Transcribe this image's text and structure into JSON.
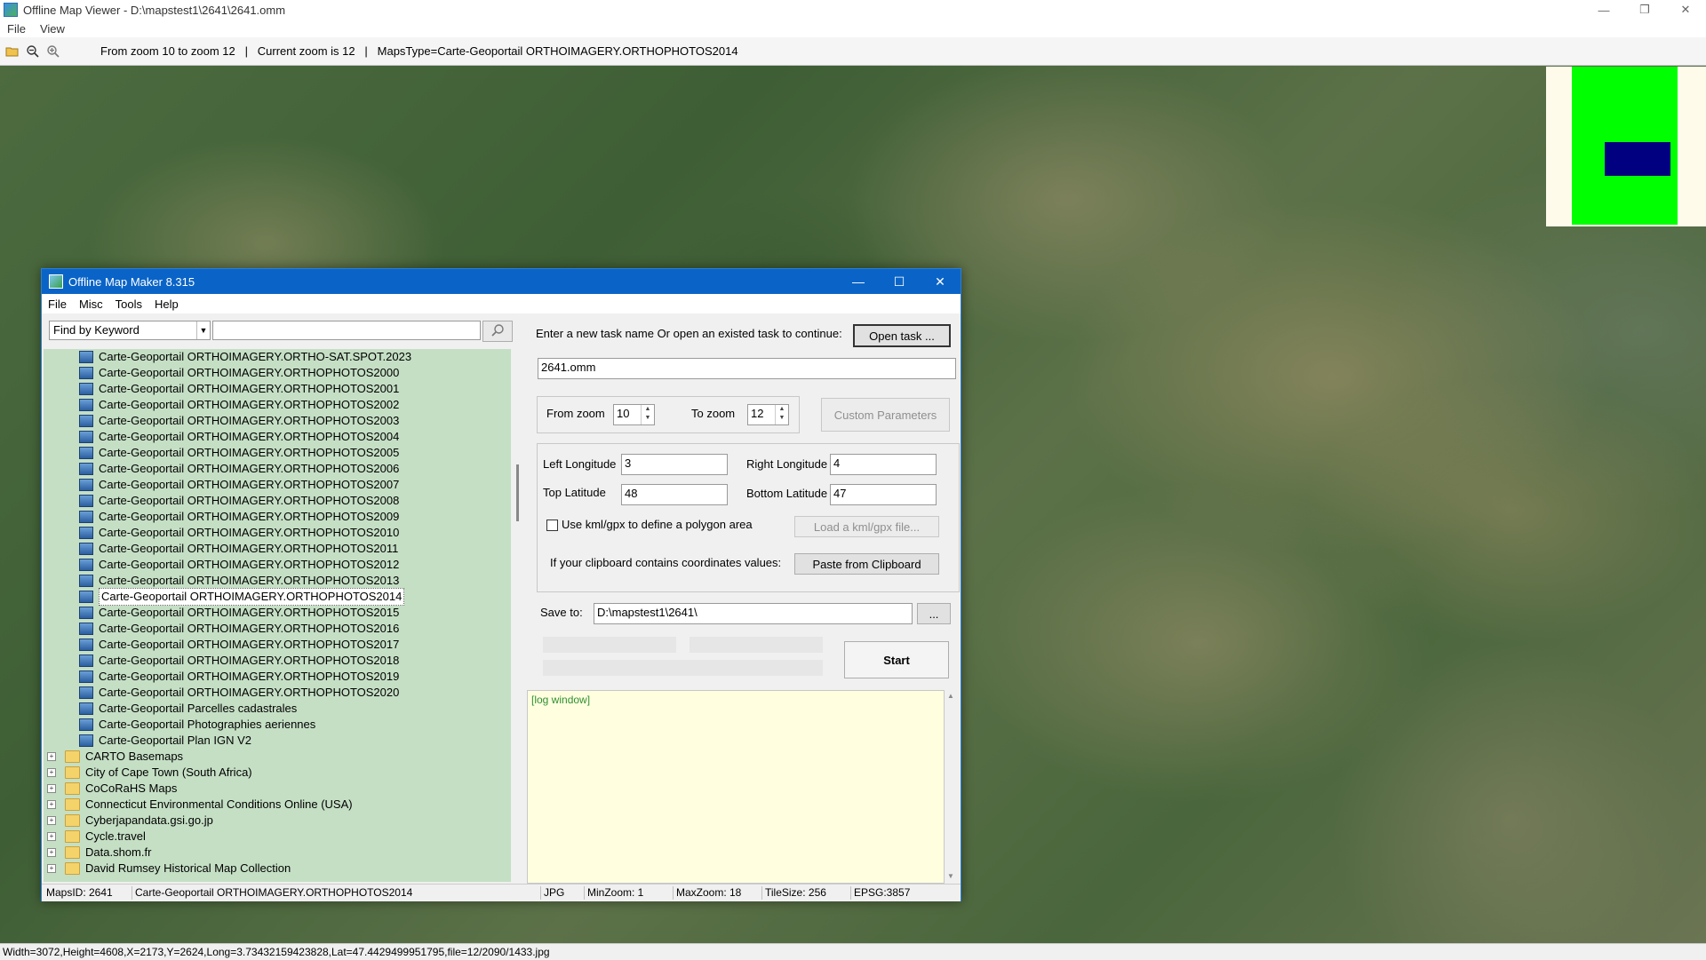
{
  "window": {
    "title": "Offline Map Viewer - D:\\mapstest1\\2641\\2641.omm",
    "controls": {
      "minimize": "—",
      "maximize": "❐",
      "close": "✕"
    }
  },
  "menu": [
    "File",
    "View"
  ],
  "toolbar": {
    "icons": [
      "open-folder-icon",
      "zoom-out-icon",
      "zoom-in-icon"
    ],
    "info": "From zoom 10 to zoom 12   |   Current zoom is 12   |   MapsType=Carte-Geoportail ORTHOIMAGERY.ORTHOPHOTOS2014"
  },
  "statusbar": "Width=3072,Height=4608,X=2173,Y=2624,Long=3.73432159423828,Lat=47.4429499951795,file=12/2090/1433.jpg",
  "dialog": {
    "title": "Offline Map Maker 8.315",
    "controls": {
      "minimize": "—",
      "maximize": "☐",
      "close": "✕"
    },
    "menu": [
      "File",
      "Misc",
      "Tools",
      "Help"
    ],
    "find": {
      "select": "Find by Keyword",
      "input": ""
    },
    "tree": {
      "items": [
        {
          "label": "Carte-Geoportail ORTHOIMAGERY.ORTHO-SAT.SPOT.2023",
          "type": "map"
        },
        {
          "label": "Carte-Geoportail ORTHOIMAGERY.ORTHOPHOTOS2000",
          "type": "map"
        },
        {
          "label": "Carte-Geoportail ORTHOIMAGERY.ORTHOPHOTOS2001",
          "type": "map"
        },
        {
          "label": "Carte-Geoportail ORTHOIMAGERY.ORTHOPHOTOS2002",
          "type": "map"
        },
        {
          "label": "Carte-Geoportail ORTHOIMAGERY.ORTHOPHOTOS2003",
          "type": "map"
        },
        {
          "label": "Carte-Geoportail ORTHOIMAGERY.ORTHOPHOTOS2004",
          "type": "map"
        },
        {
          "label": "Carte-Geoportail ORTHOIMAGERY.ORTHOPHOTOS2005",
          "type": "map"
        },
        {
          "label": "Carte-Geoportail ORTHOIMAGERY.ORTHOPHOTOS2006",
          "type": "map"
        },
        {
          "label": "Carte-Geoportail ORTHOIMAGERY.ORTHOPHOTOS2007",
          "type": "map"
        },
        {
          "label": "Carte-Geoportail ORTHOIMAGERY.ORTHOPHOTOS2008",
          "type": "map"
        },
        {
          "label": "Carte-Geoportail ORTHOIMAGERY.ORTHOPHOTOS2009",
          "type": "map"
        },
        {
          "label": "Carte-Geoportail ORTHOIMAGERY.ORTHOPHOTOS2010",
          "type": "map"
        },
        {
          "label": "Carte-Geoportail ORTHOIMAGERY.ORTHOPHOTOS2011",
          "type": "map"
        },
        {
          "label": "Carte-Geoportail ORTHOIMAGERY.ORTHOPHOTOS2012",
          "type": "map"
        },
        {
          "label": "Carte-Geoportail ORTHOIMAGERY.ORTHOPHOTOS2013",
          "type": "map"
        },
        {
          "label": "Carte-Geoportail ORTHOIMAGERY.ORTHOPHOTOS2014",
          "type": "map",
          "selected": true
        },
        {
          "label": "Carte-Geoportail ORTHOIMAGERY.ORTHOPHOTOS2015",
          "type": "map"
        },
        {
          "label": "Carte-Geoportail ORTHOIMAGERY.ORTHOPHOTOS2016",
          "type": "map"
        },
        {
          "label": "Carte-Geoportail ORTHOIMAGERY.ORTHOPHOTOS2017",
          "type": "map"
        },
        {
          "label": "Carte-Geoportail ORTHOIMAGERY.ORTHOPHOTOS2018",
          "type": "map"
        },
        {
          "label": "Carte-Geoportail ORTHOIMAGERY.ORTHOPHOTOS2019",
          "type": "map"
        },
        {
          "label": "Carte-Geoportail ORTHOIMAGERY.ORTHOPHOTOS2020",
          "type": "map"
        },
        {
          "label": "Carte-Geoportail Parcelles cadastrales",
          "type": "map"
        },
        {
          "label": "Carte-Geoportail Photographies aeriennes",
          "type": "map"
        },
        {
          "label": "Carte-Geoportail Plan IGN V2",
          "type": "map"
        },
        {
          "label": "CARTO Basemaps",
          "type": "folder"
        },
        {
          "label": "City of Cape Town (South Africa)",
          "type": "folder"
        },
        {
          "label": "CoCoRaHS Maps",
          "type": "folder"
        },
        {
          "label": "Connecticut Environmental Conditions Online (USA)",
          "type": "folder"
        },
        {
          "label": "Cyberjapandata.gsi.go.jp",
          "type": "folder"
        },
        {
          "label": "Cycle.travel",
          "type": "folder"
        },
        {
          "label": "Data.shom.fr",
          "type": "folder"
        },
        {
          "label": "David Rumsey Historical Map Collection",
          "type": "folder"
        }
      ]
    },
    "task": {
      "prompt": "Enter a new task name Or open an existed task to continue:",
      "open_button": "Open task ...",
      "name": "2641.omm"
    },
    "zoom": {
      "from_label": "From zoom",
      "from_value": "10",
      "to_label": "To zoom",
      "to_value": "12",
      "custom_button": "Custom Parameters"
    },
    "coords": {
      "left_lon_label": "Left Longitude",
      "left_lon": "3",
      "right_lon_label": "Right Longitude",
      "right_lon": "4",
      "top_lat_label": "Top Latitude",
      "top_lat": "48",
      "bottom_lat_label": "Bottom Latitude",
      "bottom_lat": "47",
      "kml_label": "Use kml/gpx to define a polygon area",
      "kml_button": "Load a kml/gpx file...",
      "clipboard_label": "If your clipboard contains coordinates values:",
      "clipboard_button": "Paste from Clipboard"
    },
    "save": {
      "label": "Save to:",
      "path": "D:\\mapstest1\\2641\\",
      "browse": "..."
    },
    "start_button": "Start",
    "log": "[log window]",
    "status": {
      "maps_id": "MapsID: 2641",
      "map_name": "Carte-Geoportail ORTHOIMAGERY.ORTHOPHOTOS2014",
      "format": "JPG",
      "min_zoom": "MinZoom: 1",
      "max_zoom": "MaxZoom: 18",
      "tile_size": "TileSize: 256",
      "epsg": "EPSG:3857"
    }
  },
  "colors": {
    "dialog_title": "#0a64c8",
    "tree_bg": "#c5dfc5",
    "log_bg": "#ffffe0",
    "overview_green": "#00ff00",
    "overview_blue": "#000080"
  }
}
